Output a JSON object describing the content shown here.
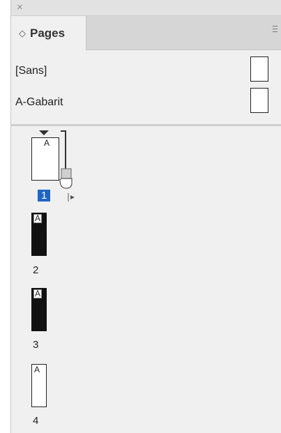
{
  "window": {
    "close_glyph": "×"
  },
  "tabs": [
    {
      "label": "Pages",
      "icon": "updown-chevron-icon",
      "chevron": "◇"
    }
  ],
  "masters": [
    {
      "label": "[Sans]"
    },
    {
      "label": "A-Gabarit"
    }
  ],
  "pages": [
    {
      "number": "1",
      "master_prefix": "A",
      "selected": true,
      "style": "white"
    },
    {
      "number": "2",
      "master_prefix": "A",
      "selected": false,
      "style": "black"
    },
    {
      "number": "3",
      "master_prefix": "A",
      "selected": false,
      "style": "black"
    },
    {
      "number": "4",
      "master_prefix": "A",
      "selected": false,
      "style": "white"
    }
  ],
  "colors": {
    "selection": "#1f66c2",
    "panel_bg": "#f0f0f0",
    "tab_strip": "#d6d6d6"
  }
}
